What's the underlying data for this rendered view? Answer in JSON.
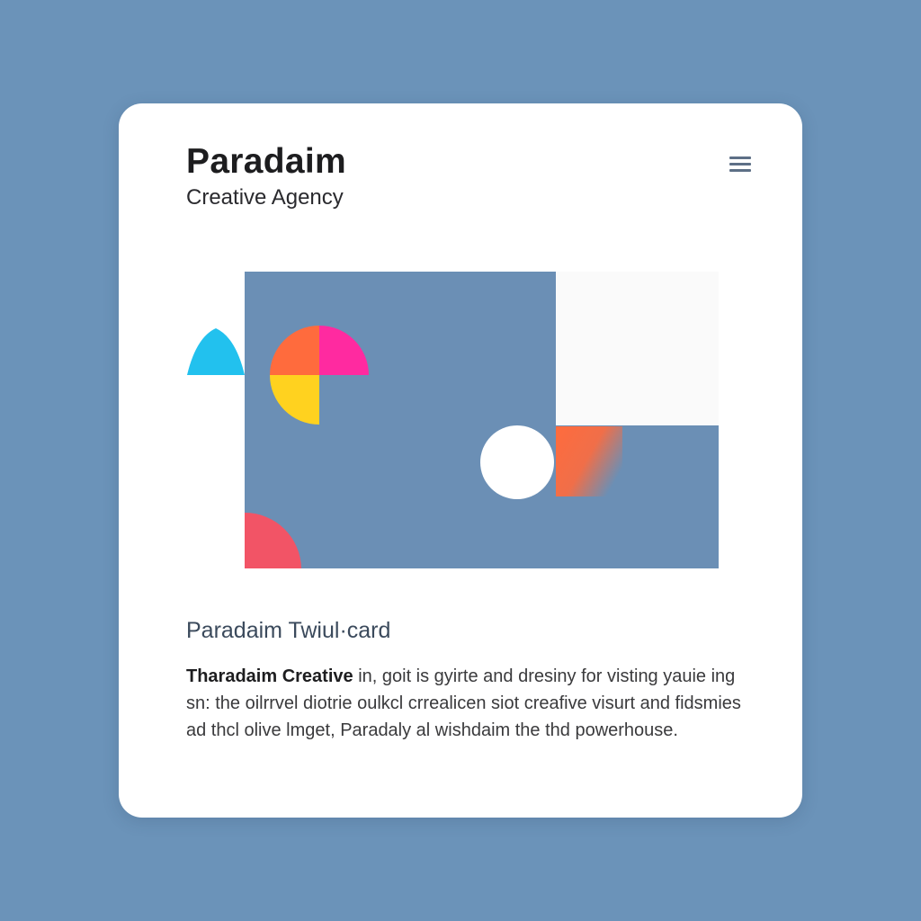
{
  "card": {
    "brand_title": "Paradaim",
    "brand_subtitle": "Creative Agency",
    "menu_icon": "hamburger-menu-icon",
    "title": "Paradaim Twiul·card",
    "body_lead": "Tharadaim Creative",
    "body_text": " in, goit is gyirte and dresiny for visting yauie ing sn: the oilrrvel diotrie oulkcl crrealicen siot creafive visurt and fidsmies ad thcl olive lmget, Paradaly al wishdaim the thd powerhouse."
  },
  "colors": {
    "page_background": "#6b93b9",
    "card_background": "#ffffff",
    "hero_panel": "#6b8fb5",
    "white_panel": "#fafafa",
    "cyan": "#22c1ee",
    "orange": "#ff6b3d",
    "magenta": "#ff2aa0",
    "yellow": "#ffd21f",
    "coral": "#f25466"
  },
  "hero_shapes": [
    "cyan-half-circle",
    "orange-quarter-circle",
    "magenta-quarter-circle",
    "yellow-quarter-circle",
    "white-circle",
    "orange-gradient-square",
    "coral-quarter-circle"
  ]
}
